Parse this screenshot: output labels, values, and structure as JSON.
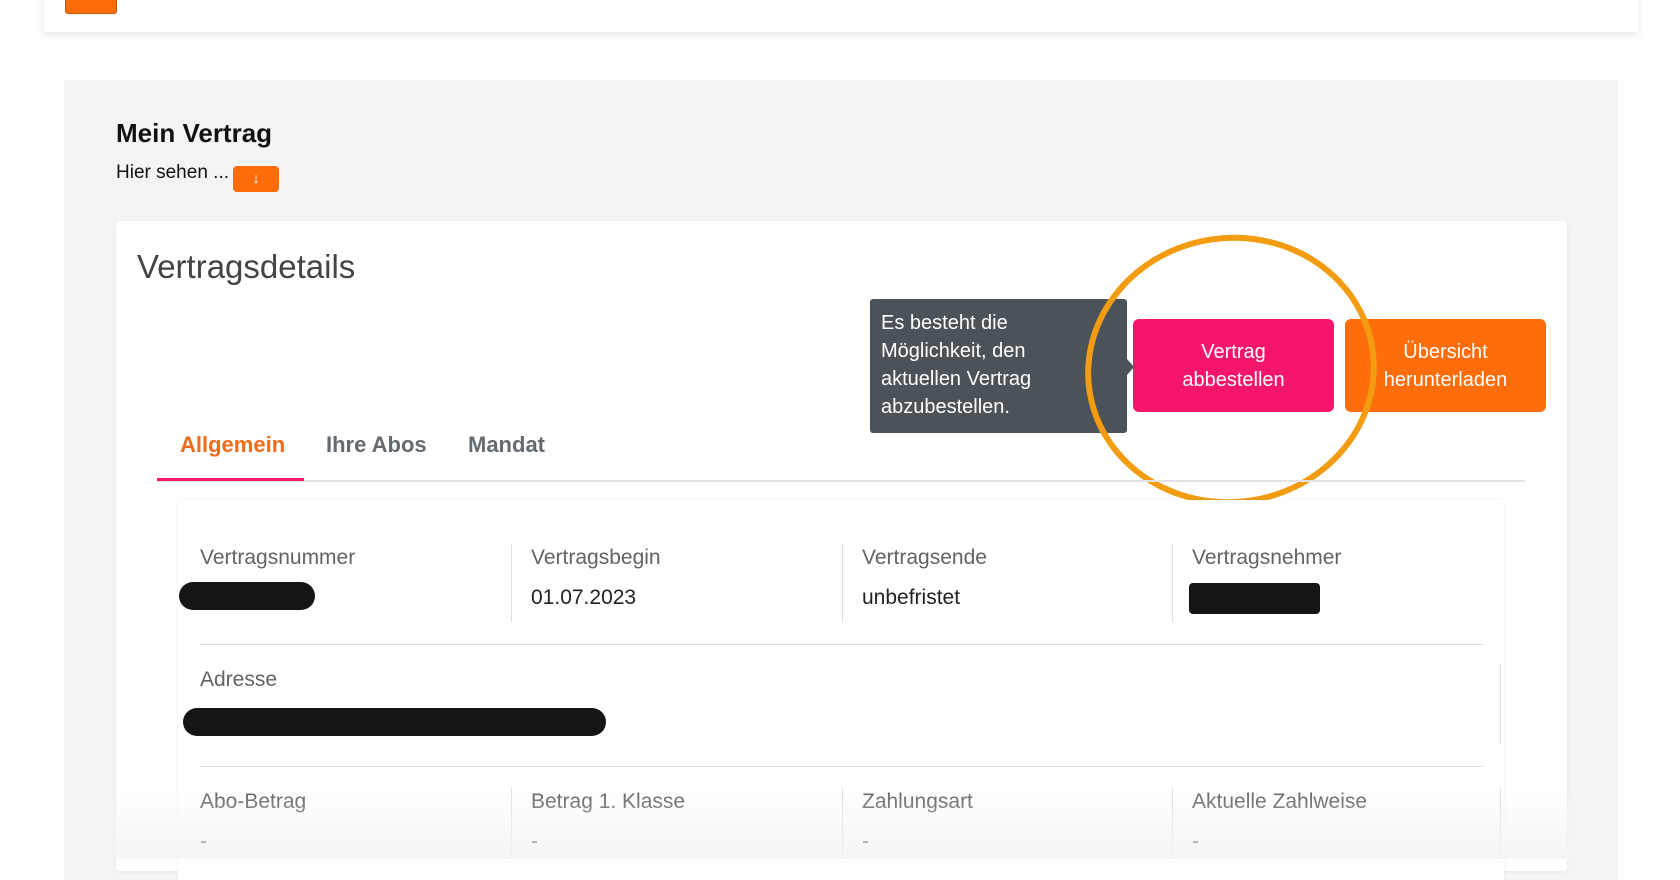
{
  "section": {
    "title": "Mein Vertrag",
    "subtitle": "Hier sehen ...",
    "expand_icon": "↓"
  },
  "card": {
    "title": "Vertragsdetails"
  },
  "buttons": {
    "cancel_label": "Vertrag\nabbestellen",
    "download_label": "Übersicht\nherunterladen"
  },
  "tooltip": {
    "text": "Es besteht die\nMöglichkeit, den\naktuellen Vertrag\nabzubestellen."
  },
  "tabs": [
    {
      "label": "Allgemein",
      "active": true
    },
    {
      "label": "Ihre Abos",
      "active": false
    },
    {
      "label": "Mandat",
      "active": false
    }
  ],
  "details": {
    "row1": [
      {
        "label": "Vertragsnummer",
        "value": ""
      },
      {
        "label": "Vertragsbegin",
        "value": "01.07.2023"
      },
      {
        "label": "Vertragsende",
        "value": "unbefristet"
      },
      {
        "label": "Vertragsnehmer",
        "value": ""
      }
    ],
    "address": {
      "label": "Adresse",
      "value": ""
    },
    "row3": [
      {
        "label": "Abo-Betrag",
        "value": "-"
      },
      {
        "label": "Betrag 1. Klasse",
        "value": "-"
      },
      {
        "label": "Zahlungsart",
        "value": "-"
      },
      {
        "label": "Aktuelle Zahlweise",
        "value": "-"
      }
    ]
  },
  "colors": {
    "accent_orange": "#ff6d0a",
    "accent_pink": "#f5166b",
    "tooltip_bg": "#4b5258",
    "highlight_ring": "#f39c12",
    "panel_bg": "#f4f4f4"
  }
}
